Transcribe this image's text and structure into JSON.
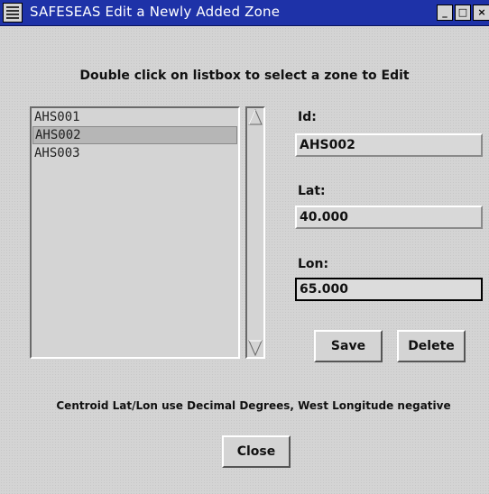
{
  "window": {
    "title": "SAFESEAS Edit a Newly Added Zone"
  },
  "heading": "Double click on listbox to select a zone to Edit",
  "zone_list": {
    "items": [
      "AHS001",
      "AHS002",
      "AHS003"
    ],
    "selected": "AHS002"
  },
  "form": {
    "id_label": "Id:",
    "id_value": "AHS002",
    "lat_label": "Lat:",
    "lat_value": "40.000",
    "lon_label": "Lon:",
    "lon_value": "65.000"
  },
  "buttons": {
    "save": "Save",
    "delete": "Delete",
    "close": "Close"
  },
  "note": "Centroid Lat/Lon use Decimal Degrees, West Longitude negative"
}
